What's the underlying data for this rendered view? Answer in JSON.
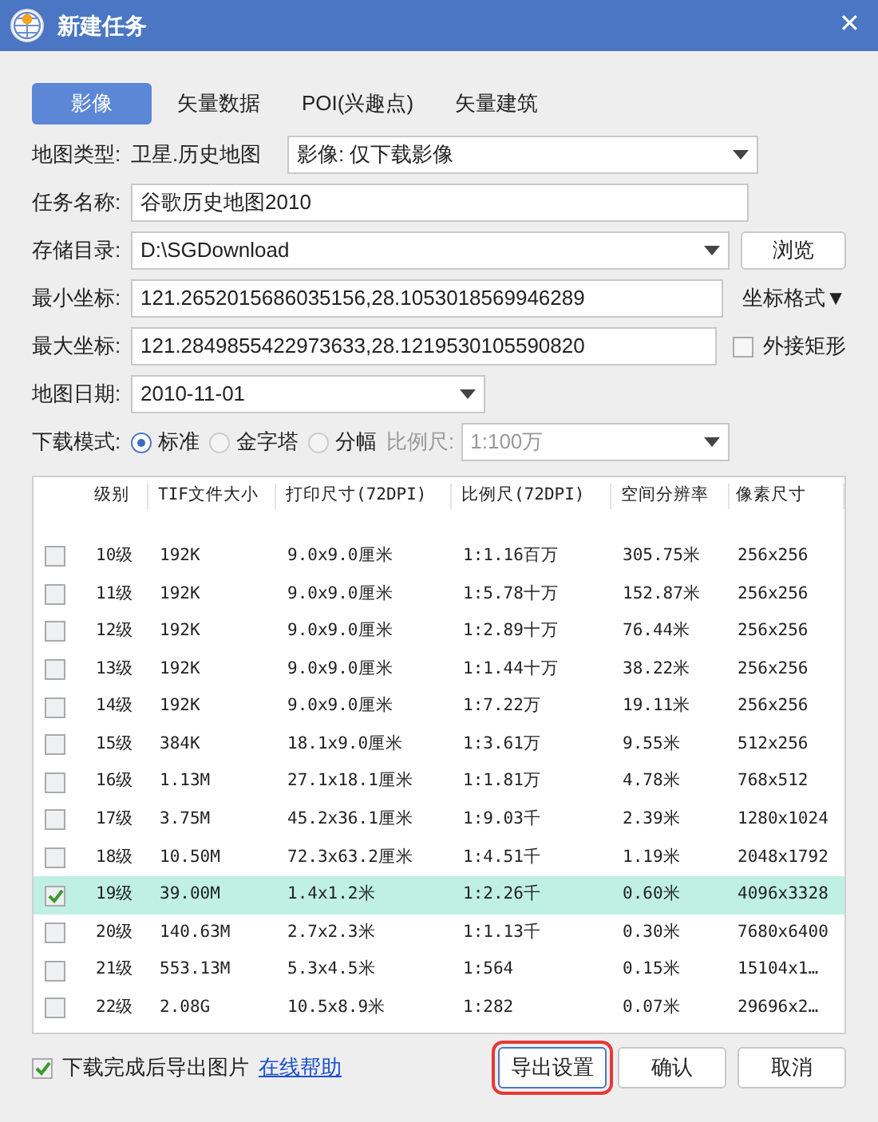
{
  "window": {
    "title": "新建任务",
    "close": "✕"
  },
  "tabs": [
    {
      "label": "影像",
      "selected": true
    },
    {
      "label": "矢量数据",
      "selected": false
    },
    {
      "label": "POI(兴趣点)",
      "selected": false
    },
    {
      "label": "矢量建筑",
      "selected": false
    }
  ],
  "form": {
    "map_type": {
      "label": "地图类型:",
      "source": "卫星.历史地图",
      "value": "影像: 仅下载影像"
    },
    "task_name": {
      "label": "任务名称:",
      "value": "谷歌历史地图2010"
    },
    "storage": {
      "label": "存储目录:",
      "value": "D:\\SGDownload",
      "button": "浏览"
    },
    "min_coord": {
      "label": "最小坐标:",
      "value": "121.2652015686035156,28.1053018569946289",
      "menu": "坐标格式▼"
    },
    "max_coord": {
      "label": "最大坐标:",
      "value": "121.2849855422973633,28.1219530105590820",
      "checkbox": {
        "label": "外接矩形",
        "checked": false
      }
    },
    "date": {
      "label": "地图日期:",
      "value": "2010-11-01"
    },
    "mode": {
      "label": "下载模式:",
      "options": [
        {
          "label": "标准",
          "selected": true
        },
        {
          "label": "金字塔",
          "selected": false
        },
        {
          "label": "分幅",
          "selected": false
        }
      ],
      "scale_label": "比例尺:",
      "scale_value": "1:100万",
      "scale_disabled": true
    }
  },
  "table": {
    "columns": [
      "级别",
      "TIF文件大小",
      "打印尺寸(72DPI)",
      "比例尺(72DPI)",
      "空间分辨率",
      "像素尺寸"
    ],
    "rows": [
      {
        "checked": false,
        "cells": [
          "10级",
          "192K",
          "9.0x9.0厘米",
          "1:1.16百万",
          "305.75米",
          "256x256"
        ]
      },
      {
        "checked": false,
        "cells": [
          "11级",
          "192K",
          "9.0x9.0厘米",
          "1:5.78十万",
          "152.87米",
          "256x256"
        ]
      },
      {
        "checked": false,
        "cells": [
          "12级",
          "192K",
          "9.0x9.0厘米",
          "1:2.89十万",
          "76.44米",
          "256x256"
        ]
      },
      {
        "checked": false,
        "cells": [
          "13级",
          "192K",
          "9.0x9.0厘米",
          "1:1.44十万",
          "38.22米",
          "256x256"
        ]
      },
      {
        "checked": false,
        "cells": [
          "14级",
          "192K",
          "9.0x9.0厘米",
          "1:7.22万",
          "19.11米",
          "256x256"
        ]
      },
      {
        "checked": false,
        "cells": [
          "15级",
          "384K",
          "18.1x9.0厘米",
          "1:3.61万",
          "9.55米",
          "512x256"
        ]
      },
      {
        "checked": false,
        "cells": [
          "16级",
          "1.13M",
          "27.1x18.1厘米",
          "1:1.81万",
          "4.78米",
          "768x512"
        ]
      },
      {
        "checked": false,
        "cells": [
          "17级",
          "3.75M",
          "45.2x36.1厘米",
          "1:9.03千",
          "2.39米",
          "1280x1024"
        ]
      },
      {
        "checked": false,
        "cells": [
          "18级",
          "10.50M",
          "72.3x63.2厘米",
          "1:4.51千",
          "1.19米",
          "2048x1792"
        ]
      },
      {
        "checked": true,
        "cells": [
          "19级",
          "39.00M",
          "1.4x1.2米",
          "1:2.26千",
          "0.60米",
          "4096x3328"
        ]
      },
      {
        "checked": false,
        "cells": [
          "20级",
          "140.63M",
          "2.7x2.3米",
          "1:1.13千",
          "0.30米",
          "7680x6400"
        ]
      },
      {
        "checked": false,
        "cells": [
          "21级",
          "553.13M",
          "5.3x4.5米",
          "1:564",
          "0.15米",
          "15104x1…"
        ]
      },
      {
        "checked": false,
        "cells": [
          "22级",
          "2.08G",
          "10.5x8.9米",
          "1:282",
          "0.07米",
          "29696x2…"
        ]
      }
    ]
  },
  "footer": {
    "export_checkbox": {
      "label": "下载完成后导出图片",
      "checked": true
    },
    "help_link": "在线帮助",
    "buttons": [
      {
        "label": "导出设置",
        "highlighted": true
      },
      {
        "label": "确认",
        "highlighted": false
      },
      {
        "label": "取消",
        "highlighted": false
      }
    ]
  }
}
